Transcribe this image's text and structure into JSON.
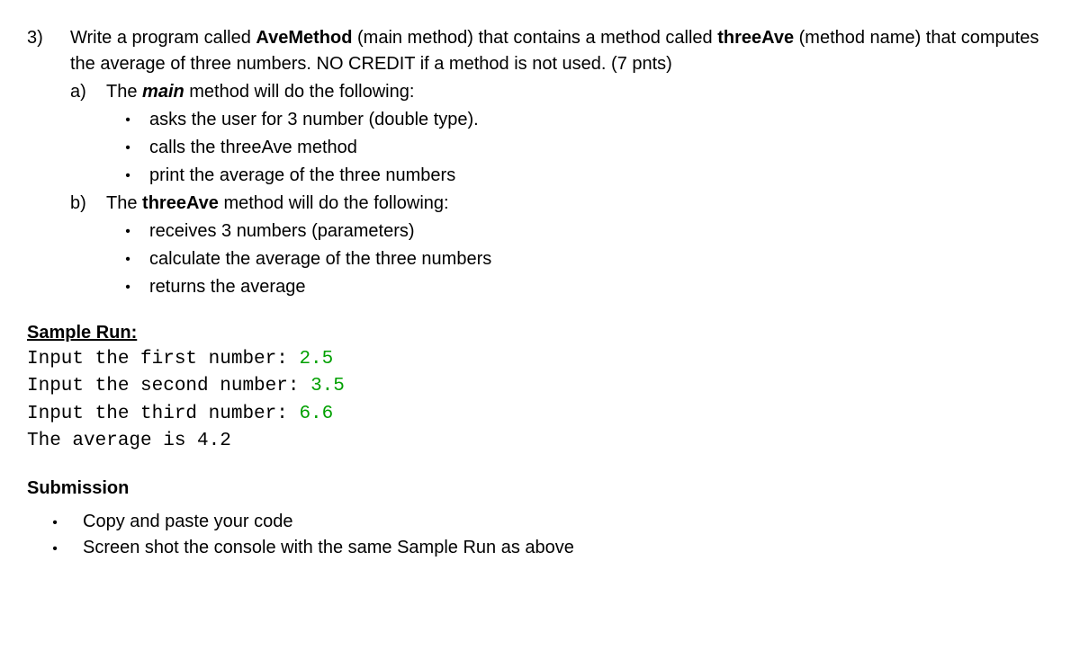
{
  "question": {
    "number": "3)",
    "intro_pre": "Write a program called ",
    "intro_b1": "AveMethod",
    "intro_mid1": " (main method) that contains a method called ",
    "intro_b2": "threeAve",
    "intro_mid2": " (method name) that computes the average of three numbers. NO CREDIT if a method is not used. (7 pnts)",
    "part_a": {
      "label": "a)",
      "lead_pre": "The ",
      "lead_bi": "main",
      "lead_post": " method will do the following:",
      "bullets": [
        "asks the user for 3 number (double type).",
        "calls the threeAve method",
        "print the average of the three numbers"
      ]
    },
    "part_b": {
      "label": "b)",
      "lead_pre": "The ",
      "lead_b": "threeAve",
      "lead_post": " method will do the following:",
      "bullets": [
        "receives 3 numbers (parameters)",
        "calculate the average of the three numbers",
        "returns the average"
      ]
    }
  },
  "sample": {
    "title": "Sample Run:",
    "line1_prompt": "Input the first number: ",
    "line1_val": "2.5",
    "line2_prompt": "Input the second number: ",
    "line2_val": "3.5",
    "line3_prompt": "Input the third number: ",
    "line3_val": "6.6",
    "line4": "The average is 4.2"
  },
  "submission": {
    "title": "Submission",
    "bullets": [
      "Copy and paste your code",
      "Screen shot the console with the same Sample Run as above"
    ]
  }
}
